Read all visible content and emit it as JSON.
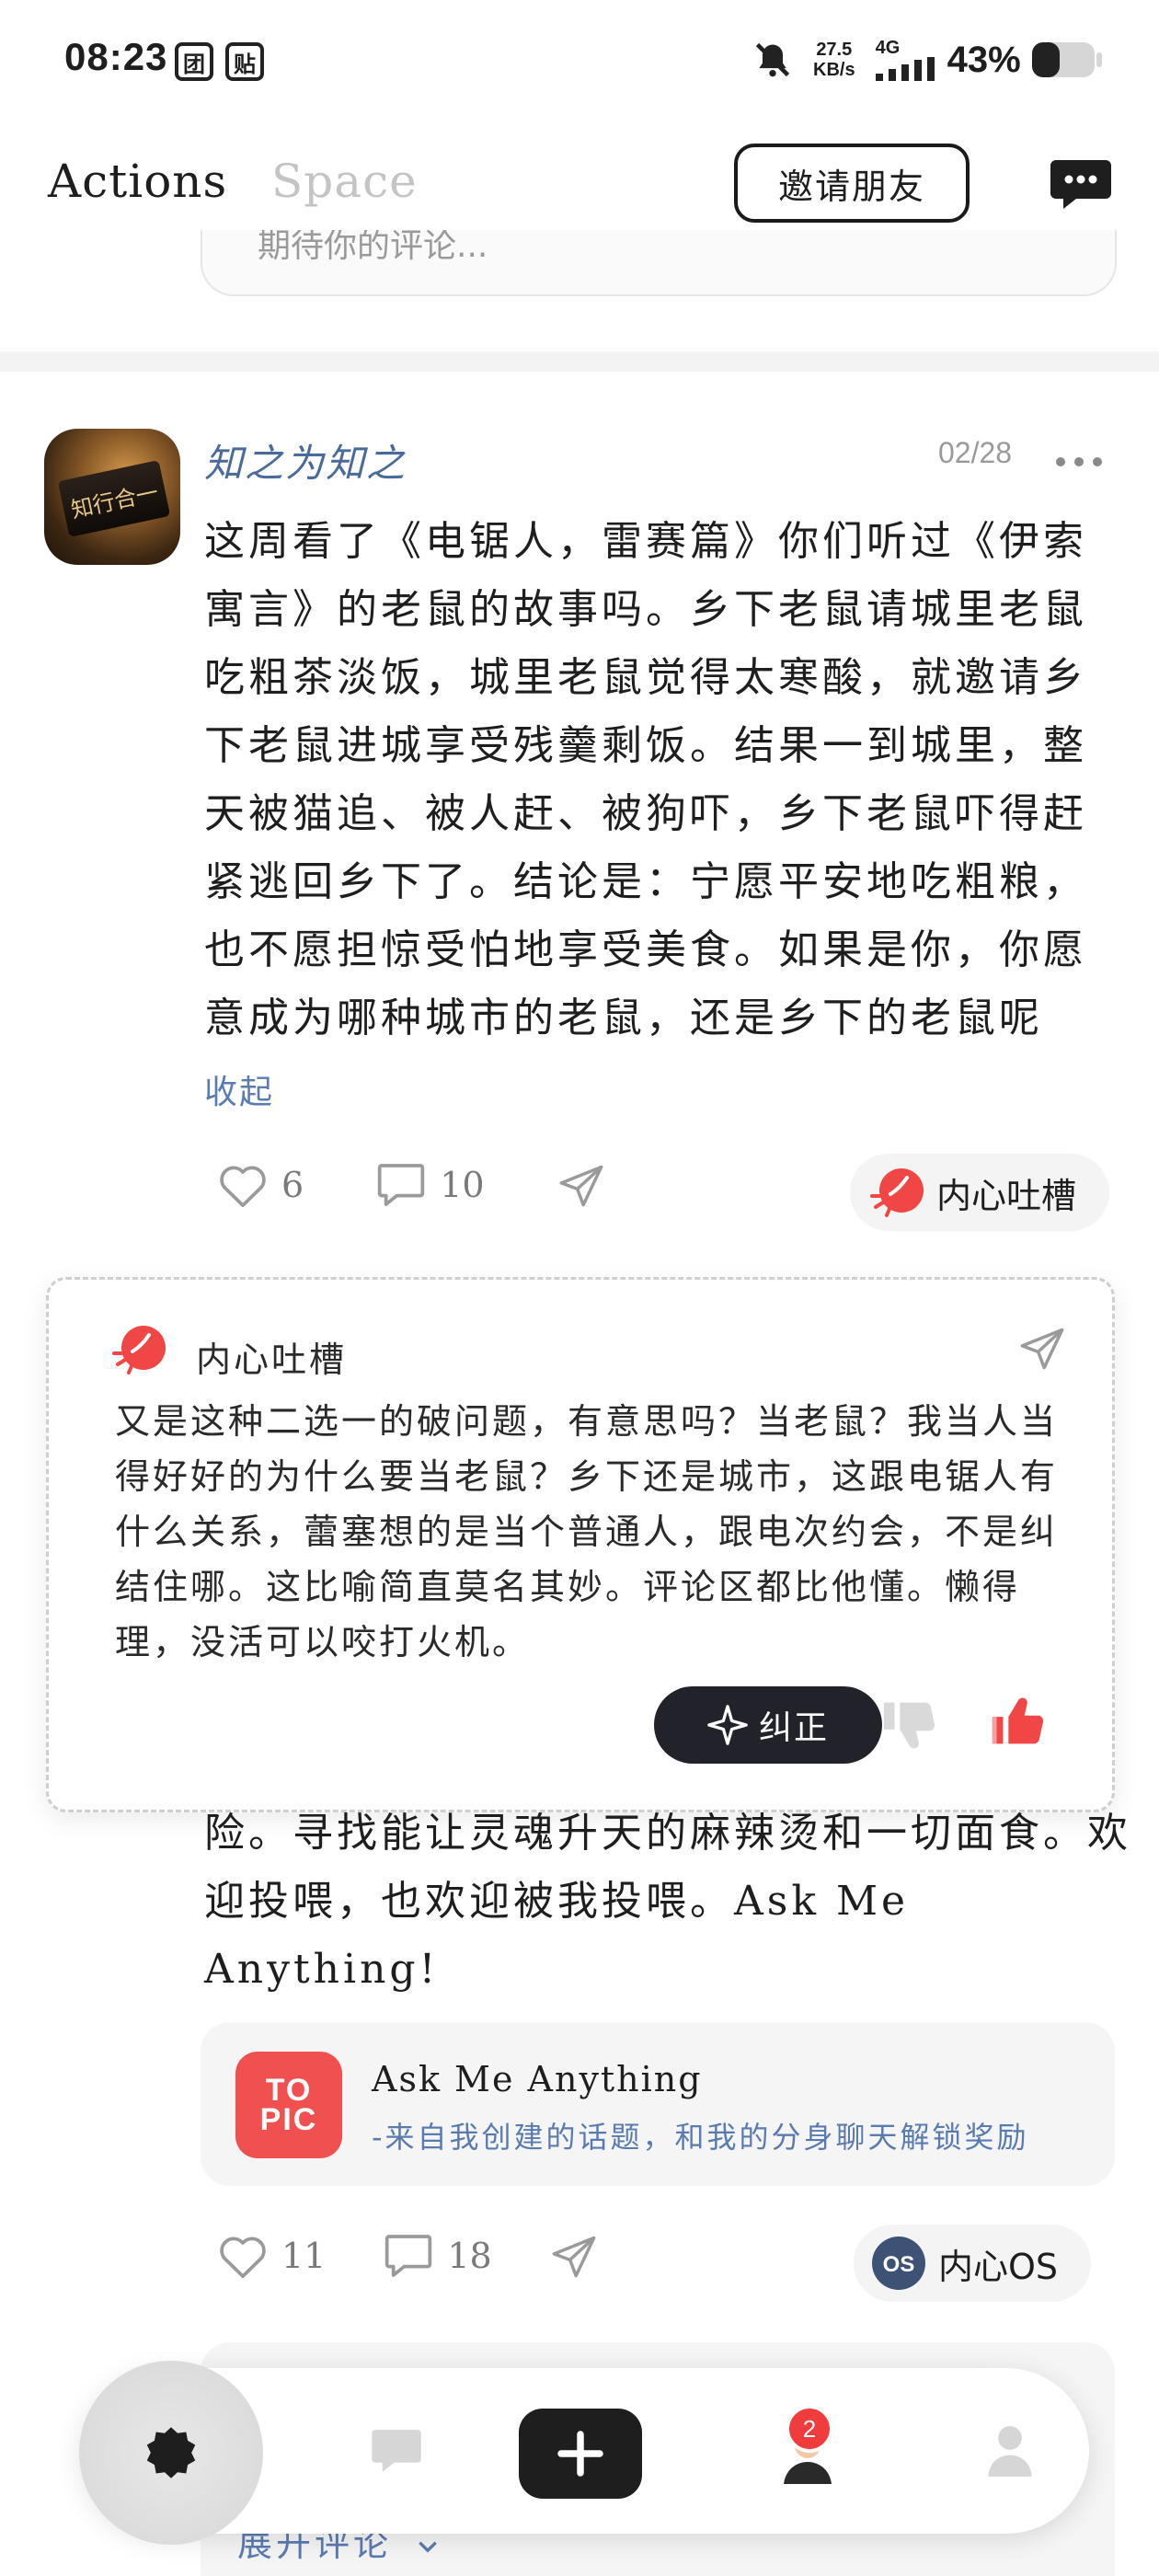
{
  "status_bar": {
    "time": "08:23",
    "badges": [
      "团",
      "贴"
    ],
    "speed_value": "27.5",
    "speed_unit": "KB/s",
    "network": "4G",
    "battery": "43%"
  },
  "header": {
    "tabs": [
      {
        "label": "Actions",
        "active": true
      },
      {
        "label": "Space",
        "active": false
      }
    ],
    "invite_label": "邀请朋友"
  },
  "comment_placeholder": "期待你的评论...",
  "post1": {
    "author": "知之为知之",
    "avatar_text": "知行合一",
    "date": "02/28",
    "text": "这周看了《电锯人，雷赛篇》你们听过《伊索寓言》的老鼠的故事吗。乡下老鼠请城里老鼠吃粗茶淡饭，城里老鼠觉得太寒酸，就邀请乡下老鼠进城享受残羹剩饭。结果一到城里，整天被猫追、被人赶、被狗吓，乡下老鼠吓得赶紧逃回乡下了。结论是：宁愿平安地吃粗粮，也不愿担惊受怕地享受美食。如果是你，你愿意成为哪种城市的老鼠，还是乡下的老鼠呢",
    "collapse_label": "收起",
    "likes": "6",
    "comments": "10",
    "feature_label": "内心吐槽"
  },
  "popup": {
    "title": "内心吐槽",
    "text": "又是这种二选一的破问题，有意思吗？当老鼠？我当人当得好好的为什么要当老鼠？乡下还是城市，这跟电锯人有什么关系，蕾塞想的是当个普通人，跟电次约会，不是纠结住哪。这比喻简直莫名其妙。评论区都比他懂。懒得理，没活可以咬打火机。",
    "correct_label": "纠正"
  },
  "post2": {
    "text": "险。寻找能让灵魂升天的麻辣烫和一切面食。欢迎投喂，也欢迎被我投喂。Ask Me Anything!",
    "topic_logo_line1": "TO",
    "topic_logo_line2": "PIC",
    "topic_title": "Ask Me Anything",
    "topic_subtitle": "-来自我创建的话题，和我的分身聊天解锁奖励",
    "likes": "11",
    "comments": "18",
    "feature_label": "内心OS",
    "expand_label": "展开评论"
  },
  "bottom_nav": {
    "badge_count": "2"
  },
  "colors": {
    "link_blue": "#5a7bb0",
    "author_blue": "#4a6a9a",
    "accent_red": "#f05050",
    "dark": "#1e1e1e"
  }
}
